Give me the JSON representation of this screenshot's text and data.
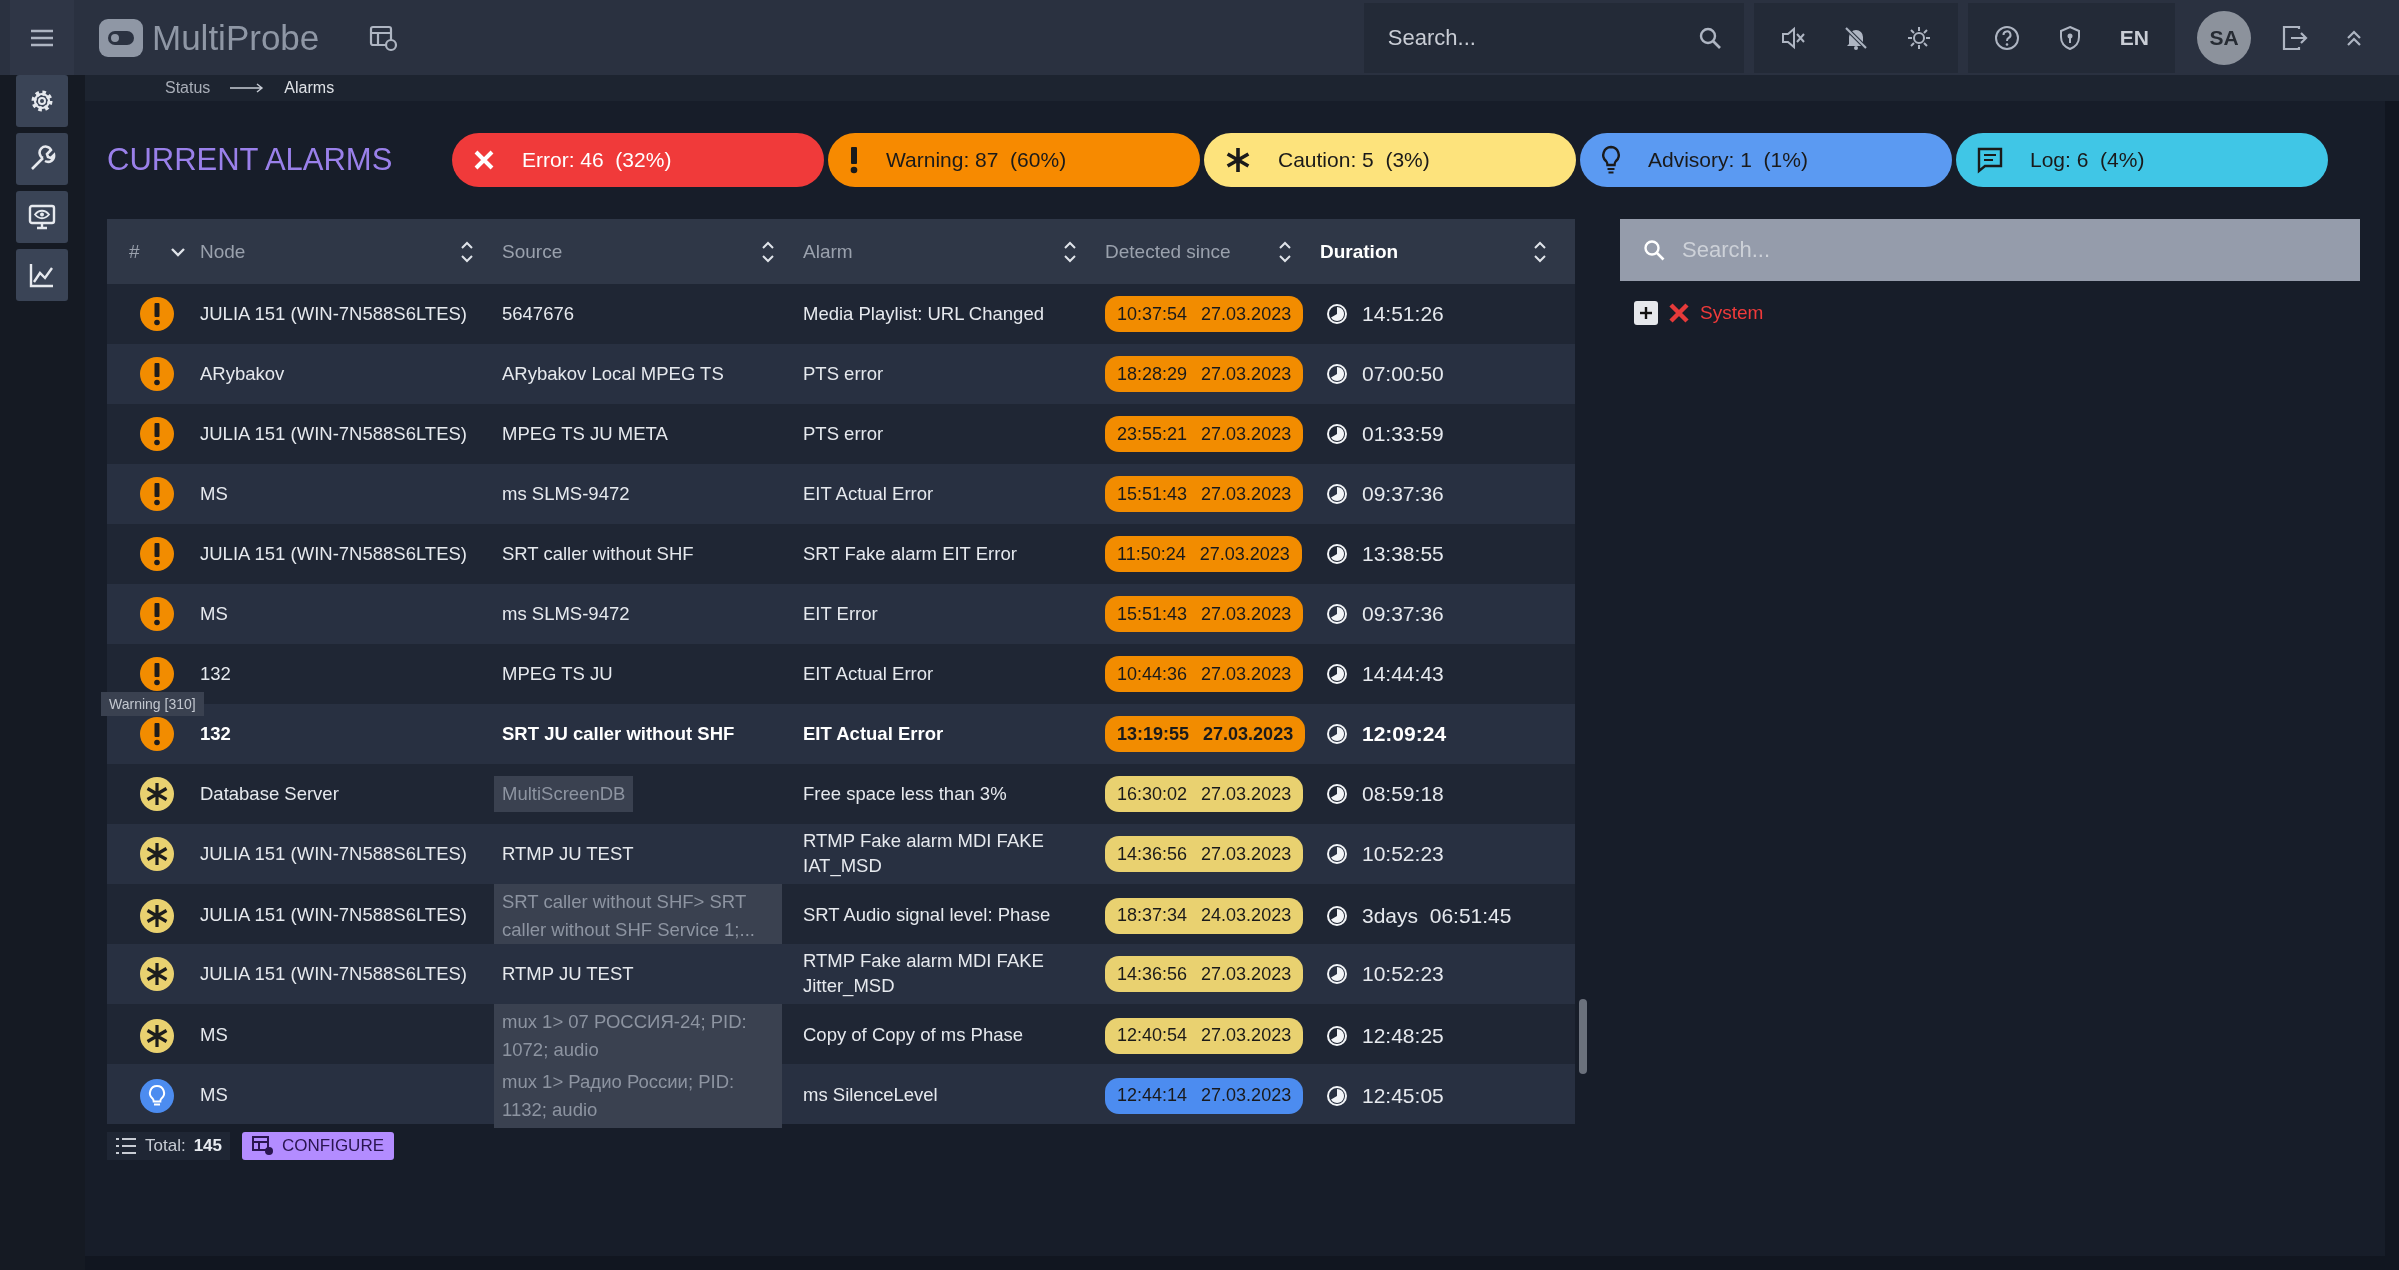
{
  "topbar": {
    "logo": "MultiProbe",
    "search": {
      "placeholder": "Search..."
    },
    "language": "EN",
    "avatar": "SA"
  },
  "breadcrumb": [
    "Status",
    "Alarms"
  ],
  "title": "CURRENT ALARMS",
  "summary": [
    {
      "kind": "error",
      "label": "Error:",
      "count": "46",
      "percent": "(32%)"
    },
    {
      "kind": "warning",
      "label": "Warning:",
      "count": "87",
      "percent": "(60%)"
    },
    {
      "kind": "caution",
      "label": "Caution:",
      "count": "5",
      "percent": "(3%)"
    },
    {
      "kind": "advisory",
      "label": "Advisory:",
      "count": "1",
      "percent": "(1%)"
    },
    {
      "kind": "log",
      "label": "Log:",
      "count": "6",
      "percent": "(4%)"
    }
  ],
  "table": {
    "columns": [
      {
        "kind": "index",
        "label": "#",
        "selected": false
      },
      {
        "kind": "sortable",
        "label": "Node",
        "selected": false
      },
      {
        "kind": "sortable",
        "label": "Source",
        "selected": false
      },
      {
        "kind": "sortable",
        "label": "Alarm",
        "selected": false
      },
      {
        "kind": "sortable",
        "label": "Detected since",
        "selected": false
      },
      {
        "kind": "sortable",
        "label": "Duration",
        "selected": true
      }
    ],
    "rows": [
      {
        "kind": "warning",
        "node": "JULIA 151 (WIN-7N588S6LTES)",
        "source": "5647676",
        "source_muted": false,
        "alarm": "Media Playlist: URL Changed",
        "time": "10:37:54",
        "date": "27.03.2023",
        "duration": "14:51:26",
        "highlighted": false
      },
      {
        "kind": "warning",
        "node": "ARybakov",
        "source": "ARybakov Local MPEG TS",
        "source_muted": false,
        "alarm": "PTS error",
        "time": "18:28:29",
        "date": "27.03.2023",
        "duration": "07:00:50",
        "highlighted": false
      },
      {
        "kind": "warning",
        "node": "JULIA 151 (WIN-7N588S6LTES)",
        "source": "MPEG TS JU META",
        "source_muted": false,
        "alarm": "PTS error",
        "time": "23:55:21",
        "date": "27.03.2023",
        "duration": "01:33:59",
        "highlighted": false
      },
      {
        "kind": "warning",
        "node": "MS",
        "source": "ms SLMS-9472",
        "source_muted": false,
        "alarm": "EIT Actual Error",
        "time": "15:51:43",
        "date": "27.03.2023",
        "duration": "09:37:36",
        "highlighted": false
      },
      {
        "kind": "warning",
        "node": "JULIA 151 (WIN-7N588S6LTES)",
        "source": "SRT caller without SHF",
        "source_muted": false,
        "alarm": "SRT Fake alarm EIT Error",
        "time": "11:50:24",
        "date": "27.03.2023",
        "duration": "13:38:55",
        "highlighted": false
      },
      {
        "kind": "warning",
        "node": "MS",
        "source": "ms SLMS-9472",
        "source_muted": false,
        "alarm": "EIT Error",
        "time": "15:51:43",
        "date": "27.03.2023",
        "duration": "09:37:36",
        "highlighted": false
      },
      {
        "kind": "warning",
        "node": "132",
        "source": "MPEG TS JU",
        "source_muted": false,
        "alarm": "EIT Actual Error",
        "time": "10:44:36",
        "date": "27.03.2023",
        "duration": "14:44:43",
        "highlighted": false,
        "tooltip": "Warning [310]"
      },
      {
        "kind": "warning",
        "node": "132",
        "source": "SRT JU caller without SHF",
        "source_muted": false,
        "alarm": "EIT Actual Error",
        "time": "13:19:55",
        "date": "27.03.2023",
        "duration": "12:09:24",
        "highlighted": true
      },
      {
        "kind": "caution",
        "node": "Database Server",
        "source": "MultiScreenDB",
        "source_muted": true,
        "alarm": "Free space less than 3%",
        "time": "16:30:02",
        "date": "27.03.2023",
        "duration": "08:59:18",
        "highlighted": false
      },
      {
        "kind": "caution",
        "node": "JULIA 151 (WIN-7N588S6LTES)",
        "source": "RTMP JU TEST",
        "source_muted": false,
        "alarm": "RTMP Fake alarm MDI FAKE IAT_MSD",
        "time": "14:36:56",
        "date": "27.03.2023",
        "duration": "10:52:23",
        "highlighted": false
      },
      {
        "kind": "caution",
        "node": "JULIA 151 (WIN-7N588S6LTES)",
        "source": "SRT caller without SHF> SRT caller without SHF Service 1;...",
        "source_muted": true,
        "alarm": "SRT Audio signal level: Phase",
        "time": "18:37:34",
        "date": "24.03.2023",
        "duration": "3days  06:51:45",
        "highlighted": false
      },
      {
        "kind": "caution",
        "node": "JULIA 151 (WIN-7N588S6LTES)",
        "source": "RTMP JU TEST",
        "source_muted": false,
        "alarm": "RTMP Fake alarm MDI FAKE Jitter_MSD",
        "time": "14:36:56",
        "date": "27.03.2023",
        "duration": "10:52:23",
        "highlighted": false
      },
      {
        "kind": "caution",
        "node": "MS",
        "source": "mux 1> 07 РОССИЯ-24; PID: 1072; audio",
        "source_muted": true,
        "alarm": "Copy of Copy of ms Phase",
        "time": "12:40:54",
        "date": "27.03.2023",
        "duration": "12:48:25",
        "highlighted": false
      },
      {
        "kind": "advisory",
        "node": "MS",
        "source": "mux 1> Радио России; PID: 1132; audio",
        "source_muted": true,
        "alarm": "ms SilenceLevel",
        "time": "12:44:14",
        "date": "27.03.2023",
        "duration": "12:45:05",
        "highlighted": false
      }
    ]
  },
  "footer": {
    "total_label": "Total:",
    "total": "145",
    "configure": "CONFIGURE"
  },
  "filter": {
    "search": {
      "placeholder": "Search..."
    },
    "tree": [
      {
        "kind": "error",
        "label": "System",
        "expanded": false
      }
    ]
  }
}
